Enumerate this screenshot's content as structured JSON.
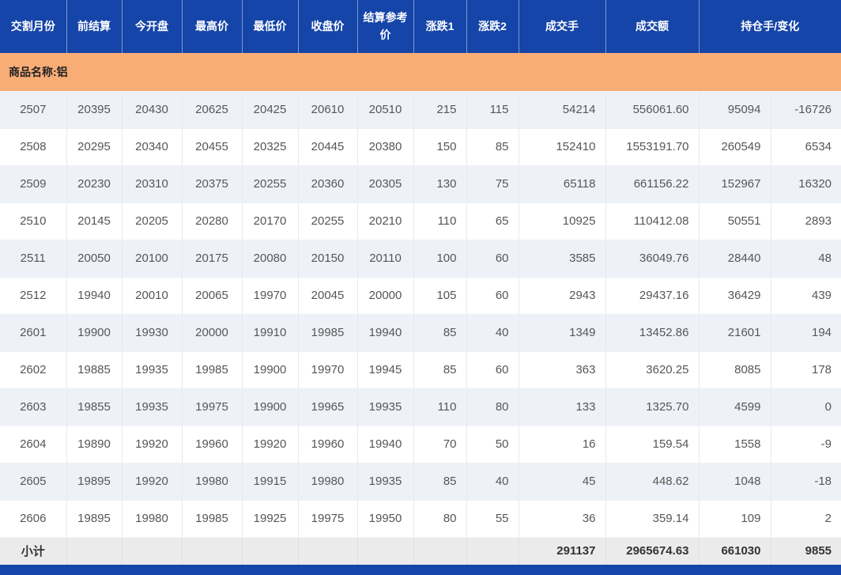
{
  "table": {
    "columns": [
      "交割月份",
      "前结算",
      "今开盘",
      "最高价",
      "最低价",
      "收盘价",
      "结算参考价",
      "涨跌1",
      "涨跌2",
      "成交手",
      "成交额",
      "持仓手/变化"
    ],
    "group_label": "商品名称:铝",
    "rows": [
      [
        "2507",
        "20395",
        "20430",
        "20625",
        "20425",
        "20610",
        "20510",
        "215",
        "115",
        "54214",
        "556061.60",
        "95094",
        "-16726"
      ],
      [
        "2508",
        "20295",
        "20340",
        "20455",
        "20325",
        "20445",
        "20380",
        "150",
        "85",
        "152410",
        "1553191.70",
        "260549",
        "6534"
      ],
      [
        "2509",
        "20230",
        "20310",
        "20375",
        "20255",
        "20360",
        "20305",
        "130",
        "75",
        "65118",
        "661156.22",
        "152967",
        "16320"
      ],
      [
        "2510",
        "20145",
        "20205",
        "20280",
        "20170",
        "20255",
        "20210",
        "110",
        "65",
        "10925",
        "110412.08",
        "50551",
        "2893"
      ],
      [
        "2511",
        "20050",
        "20100",
        "20175",
        "20080",
        "20150",
        "20110",
        "100",
        "60",
        "3585",
        "36049.76",
        "28440",
        "48"
      ],
      [
        "2512",
        "19940",
        "20010",
        "20065",
        "19970",
        "20045",
        "20000",
        "105",
        "60",
        "2943",
        "29437.16",
        "36429",
        "439"
      ],
      [
        "2601",
        "19900",
        "19930",
        "20000",
        "19910",
        "19985",
        "19940",
        "85",
        "40",
        "1349",
        "13452.86",
        "21601",
        "194"
      ],
      [
        "2602",
        "19885",
        "19935",
        "19985",
        "19900",
        "19970",
        "19945",
        "85",
        "60",
        "363",
        "3620.25",
        "8085",
        "178"
      ],
      [
        "2603",
        "19855",
        "19935",
        "19975",
        "19900",
        "19965",
        "19935",
        "110",
        "80",
        "133",
        "1325.70",
        "4599",
        "0"
      ],
      [
        "2604",
        "19890",
        "19920",
        "19960",
        "19920",
        "19960",
        "19940",
        "70",
        "50",
        "16",
        "159.54",
        "1558",
        "-9"
      ],
      [
        "2605",
        "19895",
        "19920",
        "19980",
        "19915",
        "19980",
        "19935",
        "85",
        "40",
        "45",
        "448.62",
        "1048",
        "-18"
      ],
      [
        "2606",
        "19895",
        "19980",
        "19985",
        "19925",
        "19975",
        "19950",
        "80",
        "55",
        "36",
        "359.14",
        "109",
        "2"
      ]
    ],
    "subtotal": [
      "小计",
      "",
      "",
      "",
      "",
      "",
      "",
      "",
      "",
      "291137",
      "2965674.63",
      "661030",
      "9855"
    ]
  },
  "colors": {
    "header_bg": "#1545a8",
    "header_text": "#ffffff",
    "group_bg": "#f9ad76",
    "alt_row_bg": "#eef2f8",
    "row_bg": "#ffffff",
    "subtotal_bg": "#ebebeb",
    "cell_text": "#565656",
    "footer_bg": "#1545a8"
  }
}
